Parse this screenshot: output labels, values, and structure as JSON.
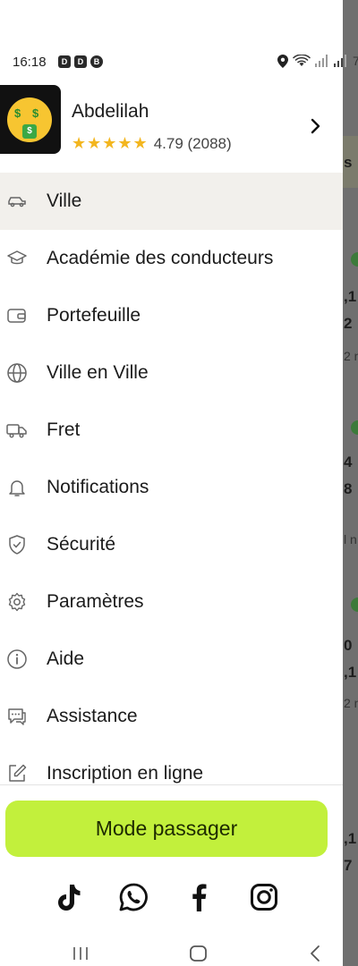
{
  "status_bar": {
    "time": "16:18",
    "left_icons": [
      "D",
      "D",
      "B"
    ],
    "battery": "7"
  },
  "profile": {
    "name": "Abdelilah",
    "stars": "★★★★★",
    "rating": "4.79 (2088)",
    "avatar_icon": "money-mouth-face-icon",
    "eye_glyph": "$"
  },
  "menu": [
    {
      "label": "Ville",
      "icon": "car-icon"
    },
    {
      "label": "Académie des conducteurs",
      "icon": "graduation-cap-icon"
    },
    {
      "label": "Portefeuille",
      "icon": "wallet-icon"
    },
    {
      "label": "Ville en Ville",
      "icon": "globe-icon"
    },
    {
      "label": "Fret",
      "icon": "truck-icon"
    },
    {
      "label": "Notifications",
      "icon": "bell-icon"
    },
    {
      "label": "Sécurité",
      "icon": "shield-check-icon"
    },
    {
      "label": "Paramètres",
      "icon": "gear-icon"
    },
    {
      "label": "Aide",
      "icon": "info-icon"
    },
    {
      "label": "Assistance",
      "icon": "chat-icon"
    },
    {
      "label": "Inscription en ligne",
      "icon": "edit-icon"
    }
  ],
  "passenger_button": {
    "label": "Mode passager"
  },
  "socials": [
    "tiktok-icon",
    "whatsapp-icon",
    "facebook-icon",
    "instagram-icon"
  ],
  "background_fragments": {
    "s": "s",
    "a": ",1",
    "b": "2",
    "c": "2 n",
    "d": "4",
    "e": "8",
    "f": "l n",
    "g": "0",
    "h": ",1",
    "i": "2 n",
    "j": ",1",
    "k": "7"
  },
  "colors": {
    "accent": "#c2f03c",
    "star": "#f3b61f",
    "active_row": "#f2f0ec"
  }
}
